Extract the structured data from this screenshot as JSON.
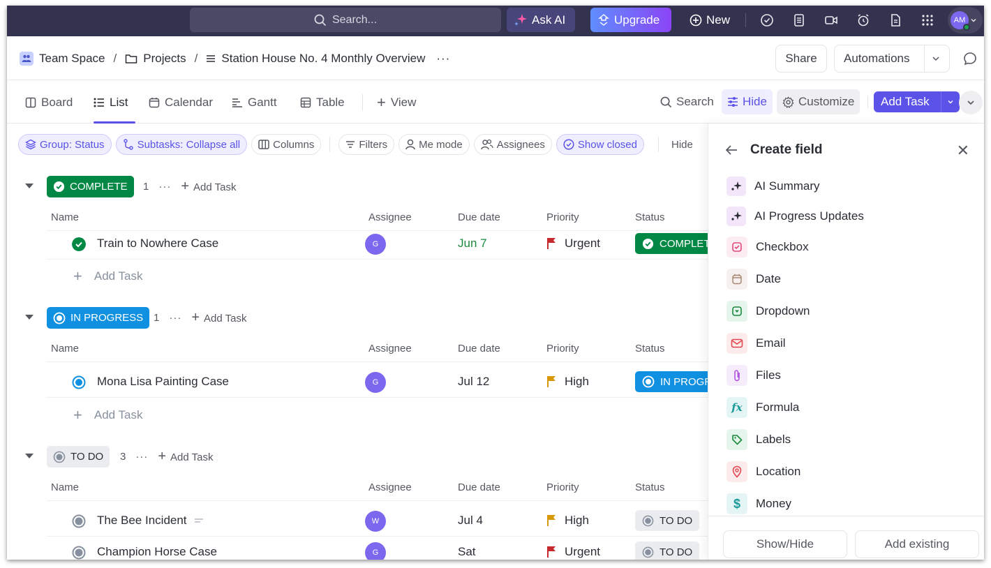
{
  "topbar": {
    "search_placeholder": "Search...",
    "ask_ai_label": "Ask AI",
    "upgrade_label": "Upgrade",
    "new_label": "New",
    "icons": [
      "check-circle-icon",
      "notepad-icon",
      "video-icon",
      "alarm-clock-icon",
      "document-icon",
      "apps-grid-icon"
    ],
    "user_initials": "AM"
  },
  "header": {
    "breadcrumb": [
      {
        "label": "Team Space",
        "icon": "team-space-icon"
      },
      {
        "label": "Projects",
        "icon": "folder-icon"
      },
      {
        "label": "Station House No. 4 Monthly Overview",
        "icon": "list-icon"
      }
    ],
    "more_label": "···",
    "share_label": "Share",
    "automations_label": "Automations"
  },
  "views": {
    "tabs": [
      {
        "label": "Board",
        "icon": "board-icon"
      },
      {
        "label": "List",
        "icon": "list-icon",
        "active": true
      },
      {
        "label": "Calendar",
        "icon": "calendar-icon"
      },
      {
        "label": "Gantt",
        "icon": "gantt-icon"
      },
      {
        "label": "Table",
        "icon": "table-icon"
      }
    ],
    "add_view_label": "View",
    "search_label": "Search",
    "hide_label": "Hide",
    "customize_label": "Customize",
    "add_task_label": "Add Task"
  },
  "filters": {
    "chips": [
      {
        "label": "Group: Status",
        "active": true
      },
      {
        "label": "Subtasks: Collapse all",
        "active": true
      },
      {
        "label": "Columns",
        "active": false
      },
      {
        "label": "Filters",
        "active": false
      },
      {
        "label": "Me mode",
        "active": false
      },
      {
        "label": "Assignees",
        "active": false
      },
      {
        "label": "Show closed",
        "active": true
      }
    ],
    "hide_label": "Hide"
  },
  "columns": {
    "name": "Name",
    "assignee": "Assignee",
    "due_date": "Due date",
    "priority": "Priority",
    "status": "Status"
  },
  "groups": [
    {
      "status": "COMPLETE",
      "color": "#008844",
      "count": "1",
      "add_task_label": "Add Task",
      "tasks": [
        {
          "name": "Train to Nowhere Case",
          "assignee": "G",
          "due": "Jun 7",
          "due_color": "#1a8a3c",
          "priority": "Urgent",
          "priority_color": "#c62a2f",
          "status": "COMPLETE",
          "status_short": "COMPLETE"
        }
      ],
      "row_add_label": "Add Task"
    },
    {
      "status": "IN PROGRESS",
      "color": "#1090e0",
      "count": "1",
      "add_task_label": "Add Task",
      "tasks": [
        {
          "name": "Mona Lisa Painting Case",
          "assignee": "G",
          "due": "Jul 12",
          "due_color": "#2a2e34",
          "priority": "High",
          "priority_color": "#d9970a",
          "status": "IN PROGRESS",
          "status_short": "IN PROGR"
        }
      ],
      "row_add_label": "Add Task"
    },
    {
      "status": "TO DO",
      "color": "#87909e",
      "count": "3",
      "add_task_label": "Add Task",
      "tasks": [
        {
          "name": "The Bee Incident",
          "assignee": "W",
          "due": "Jul 4",
          "due_color": "#2a2e34",
          "priority": "High",
          "priority_color": "#d9970a",
          "status": "TO DO",
          "status_short": "TO DO",
          "has_description": true
        },
        {
          "name": "Champion Horse Case",
          "assignee": "G",
          "due": "Sat",
          "due_color": "#2a2e34",
          "priority": "Urgent",
          "priority_color": "#c62a2f",
          "status": "TO DO",
          "status_short": "TO DO"
        }
      ]
    }
  ],
  "panel": {
    "title": "Create field",
    "fields": [
      {
        "label": "AI Summary",
        "icon": "ai-sparkle-icon",
        "color": "#2a2e34",
        "bg": "#f3e6fb"
      },
      {
        "label": "AI Progress Updates",
        "icon": "ai-sparkle-icon",
        "color": "#2a2e34",
        "bg": "#f3e6fb"
      },
      {
        "label": "Checkbox",
        "icon": "checkbox-icon",
        "color": "#e0497f",
        "bg": "#fdecf2"
      },
      {
        "label": "Date",
        "icon": "calendar-icon",
        "color": "#a98774",
        "bg": "#f6f1ee"
      },
      {
        "label": "Dropdown",
        "icon": "dropdown-icon",
        "color": "#1a8a3c",
        "bg": "#e6f5eb"
      },
      {
        "label": "Email",
        "icon": "email-icon",
        "color": "#e0474f",
        "bg": "#fdecec"
      },
      {
        "label": "Files",
        "icon": "paperclip-icon",
        "color": "#b055e0",
        "bg": "#f7ecfc"
      },
      {
        "label": "Formula",
        "icon": "formula-icon",
        "color": "#1a9a9a",
        "bg": "#e5f5f5"
      },
      {
        "label": "Labels",
        "icon": "tag-icon",
        "color": "#1a8a3c",
        "bg": "#e6f5eb"
      },
      {
        "label": "Location",
        "icon": "location-pin-icon",
        "color": "#e0474f",
        "bg": "#fdecec"
      },
      {
        "label": "Money",
        "icon": "dollar-icon",
        "color": "#1a9a9a",
        "bg": "#e5f5f5"
      }
    ],
    "show_hide_label": "Show/Hide",
    "add_existing_label": "Add existing"
  }
}
